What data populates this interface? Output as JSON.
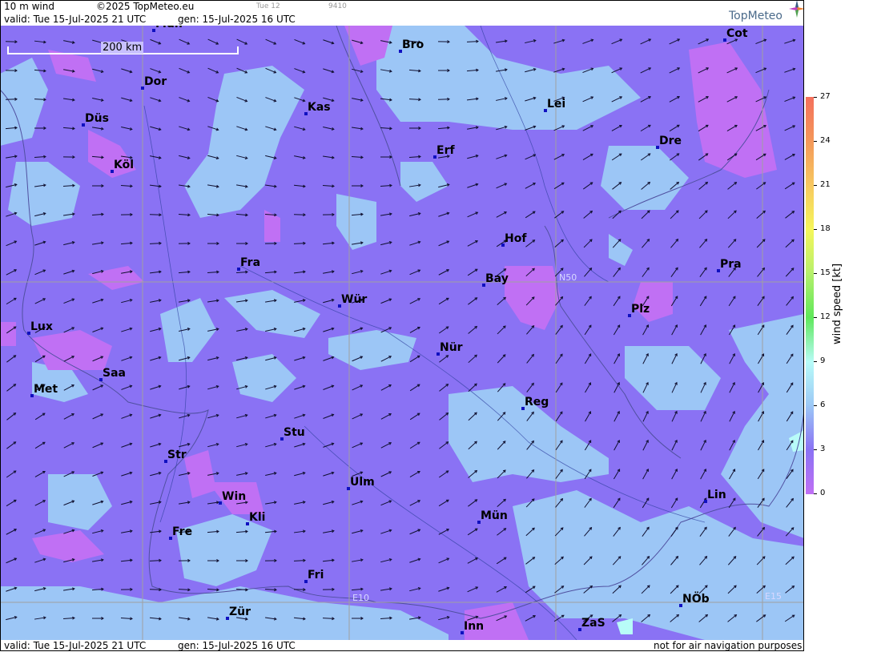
{
  "header": {
    "product": "10 m wind",
    "copyright": "©2025 TopMeteo.eu",
    "tab": "Tue 12",
    "code": "9410",
    "valid": "valid:  Tue  15-Jul-2025  21 UTC",
    "gen": "gen: 15-Jul-2025 16 UTC",
    "logo": "TopMeteo"
  },
  "footer": {
    "valid": "valid:  Tue  15-Jul-2025  21 UTC",
    "gen": "gen: 15-Jul-2025 16 UTC",
    "disclaimer": "not for air navigation purposes"
  },
  "map": {
    "scale_label": "200 km",
    "grid_labels": {
      "n50": "N50",
      "e10": "E10",
      "e15": "E15"
    },
    "cities": [
      {
        "id": "mun-top",
        "label": "Mün"
      },
      {
        "id": "bro",
        "label": "Bro"
      },
      {
        "id": "cot",
        "label": "Cot"
      },
      {
        "id": "dor",
        "label": "Dor"
      },
      {
        "id": "kas",
        "label": "Kas"
      },
      {
        "id": "lei",
        "label": "Lei"
      },
      {
        "id": "dus",
        "label": "Düs"
      },
      {
        "id": "dre",
        "label": "Dre"
      },
      {
        "id": "erf",
        "label": "Erf"
      },
      {
        "id": "kol",
        "label": "Köl"
      },
      {
        "id": "hof",
        "label": "Hof"
      },
      {
        "id": "fra",
        "label": "Fra"
      },
      {
        "id": "pra",
        "label": "Pra"
      },
      {
        "id": "bay",
        "label": "Bay"
      },
      {
        "id": "wur",
        "label": "Wür"
      },
      {
        "id": "plz",
        "label": "Plz"
      },
      {
        "id": "lux",
        "label": "Lux"
      },
      {
        "id": "nur",
        "label": "Nür"
      },
      {
        "id": "saa",
        "label": "Saa"
      },
      {
        "id": "met",
        "label": "Met"
      },
      {
        "id": "reg",
        "label": "Reg"
      },
      {
        "id": "stu",
        "label": "Stu"
      },
      {
        "id": "str",
        "label": "Str"
      },
      {
        "id": "ulm",
        "label": "Ulm"
      },
      {
        "id": "win",
        "label": "Win"
      },
      {
        "id": "lin",
        "label": "Lin"
      },
      {
        "id": "kli",
        "label": "Kli"
      },
      {
        "id": "mun",
        "label": "Mün"
      },
      {
        "id": "fre",
        "label": "Fre"
      },
      {
        "id": "fri",
        "label": "Fri"
      },
      {
        "id": "nob",
        "label": "NÖb"
      },
      {
        "id": "zur",
        "label": "Zür"
      },
      {
        "id": "zas",
        "label": "ZaS"
      },
      {
        "id": "inn",
        "label": "Inn"
      }
    ]
  },
  "colorbar": {
    "title": "wind speed [kt]",
    "ticks": [
      "27",
      "24",
      "21",
      "18",
      "15",
      "12",
      "9",
      "6",
      "3",
      "0"
    ],
    "colors": [
      "#f4705c",
      "#f4985a",
      "#f7c860",
      "#f6f65a",
      "#b6f06c",
      "#5ee85a",
      "#b8fcf8",
      "#9cc8f6",
      "#8a72f4",
      "#c070f4"
    ]
  }
}
